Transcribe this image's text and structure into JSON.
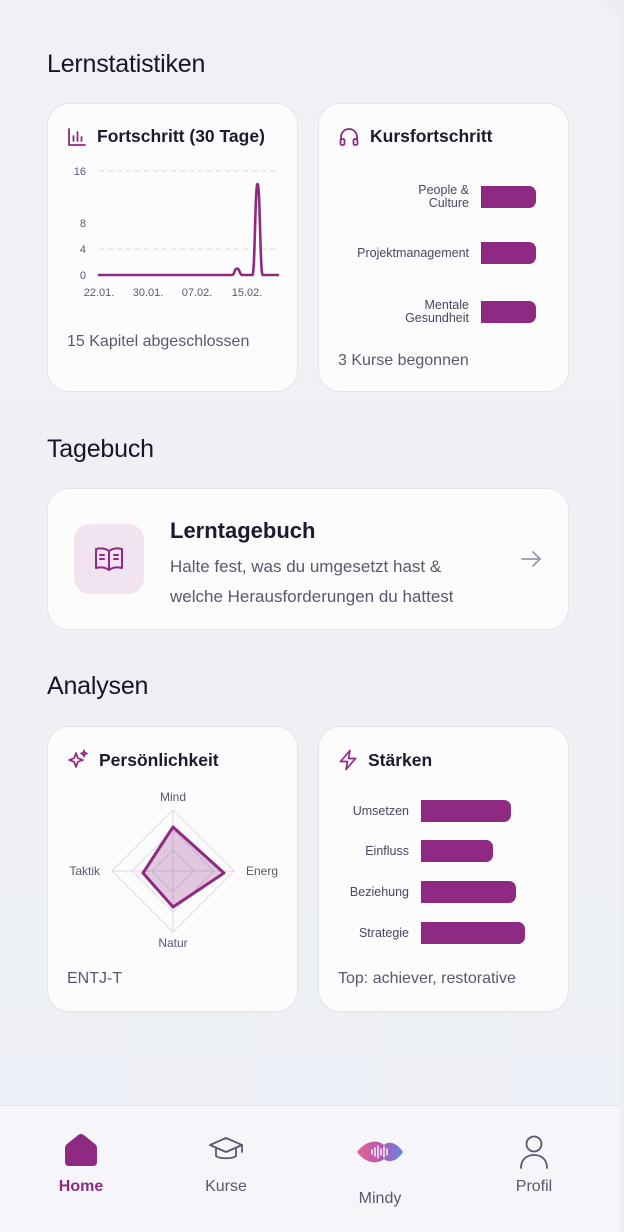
{
  "stats": {
    "title": "Lernstatistiken",
    "progress": {
      "title": "Fortschritt (30 Tage)",
      "icon": "bar-chart-icon",
      "footer": "15 Kapitel abgeschlossen",
      "y_ticks": [
        "16",
        "8",
        "4",
        "0"
      ],
      "x_ticks": [
        "22.01.",
        "30.01.",
        "07.02.",
        "15.02."
      ]
    },
    "courses": {
      "title": "Kursfortschritt",
      "icon": "headphones-icon",
      "footer": "3 Kurse begonnen",
      "items": [
        {
          "label_lines": [
            "People &",
            "Culture"
          ],
          "value": 1.0
        },
        {
          "label_lines": [
            "Projektmanagement"
          ],
          "value": 1.0
        },
        {
          "label_lines": [
            "Mentale",
            "Gesundheit"
          ],
          "value": 1.0
        }
      ]
    }
  },
  "journal": {
    "title": "Tagebuch",
    "card_title": "Lerntagebuch",
    "card_desc_line1": "Halte fest, was du umgesetzt hast &",
    "card_desc_line2": "welche Herausforderungen du hattest",
    "icon": "open-book-icon",
    "arrow_icon": "arrow-right-icon"
  },
  "analyses": {
    "title": "Analysen",
    "personality": {
      "title": "Persönlichkeit",
      "icon": "sparkles-icon",
      "footer": "ENTJ-T",
      "axes": {
        "top": "Mind",
        "right": "Energ",
        "bottom": "Natur",
        "left": "Taktik"
      }
    },
    "strengths": {
      "title": "Stärken",
      "icon": "lightning-icon",
      "footer": "Top: achiever, restorative",
      "items": [
        {
          "label": "Umsetzen",
          "value": 0.86
        },
        {
          "label": "Einfluss",
          "value": 0.69
        },
        {
          "label": "Beziehung",
          "value": 0.9
        },
        {
          "label": "Strategie",
          "value": 0.99
        }
      ]
    }
  },
  "chart_data": {
    "type": "line",
    "title": "Fortschritt (30 Tage)",
    "x": [
      "22.01.",
      "30.01.",
      "07.02.",
      "15.02."
    ],
    "ylim": [
      0,
      16
    ],
    "y_ticks": [
      0,
      4,
      8,
      16
    ],
    "series": [
      {
        "values": [
          [
            0,
            0
          ],
          [
            26,
            0
          ],
          [
            27,
            1
          ],
          [
            28,
            0
          ],
          [
            30,
            0
          ],
          [
            31,
            14
          ],
          [
            32,
            0
          ],
          [
            35,
            0
          ]
        ]
      }
    ],
    "grid": true
  },
  "nav": {
    "items": [
      {
        "label": "Home",
        "icon": "home-icon",
        "active": true
      },
      {
        "label": "Kurse",
        "icon": "graduation-cap-icon",
        "active": false
      },
      {
        "label": "Mindy",
        "icon": "mindy-wave-icon",
        "active": false
      },
      {
        "label": "Profil",
        "icon": "user-icon",
        "active": false
      }
    ]
  },
  "colors": {
    "accent": "#8e2a84",
    "accent_light": "#f1e3ef",
    "text": "#1c1a2e",
    "muted": "#5b576e"
  }
}
